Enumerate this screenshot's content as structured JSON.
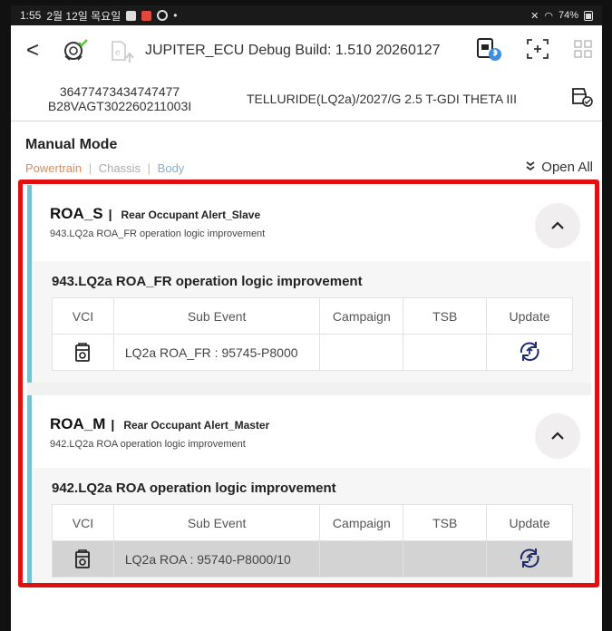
{
  "status_bar": {
    "time": "1:55",
    "date": "2월 12일 목요일",
    "battery": "74%"
  },
  "app_bar": {
    "back_label": "<",
    "title": "JUPITER_ECU Debug Build: 1.510 20260127",
    "icons": [
      "ecu-check-icon",
      "ecu-upload-icon",
      "bluetooth-vci-icon",
      "screen-capture-icon",
      "grid-menu-icon"
    ]
  },
  "vehicle": {
    "vin_line1": "36477473434747477",
    "vin_line2": "B28VAGT302260211003I",
    "model": "TELLURIDE(LQ2a)/2027/G 2.5 T-GDI THETA III"
  },
  "manual_mode": {
    "title": "Manual Mode",
    "filters": [
      "Powertrain",
      "Chassis",
      "Body"
    ],
    "separator": "|",
    "open_all": "Open All"
  },
  "colors": {
    "highlight": "#e01010",
    "accent": "#78c2cf",
    "powertrain": "#d98a5a",
    "body": "#7fb3d8"
  },
  "table_headers": [
    "VCI",
    "Sub Event",
    "Campaign",
    "TSB",
    "Update"
  ],
  "cards": [
    {
      "code": "ROA_S",
      "name": "Rear Occupant Alert_Slave",
      "subtitle": "943.LQ2a ROA_FR operation logic improvement",
      "body_title": "943.LQ2a ROA_FR operation logic improvement",
      "row": {
        "sub_event": "LQ2a ROA_FR : 95745-P8000",
        "campaign": "",
        "tsb": "",
        "selected": false
      }
    },
    {
      "code": "ROA_M",
      "name": "Rear Occupant Alert_Master",
      "subtitle": "942.LQ2a ROA operation logic improvement",
      "body_title": "942.LQ2a ROA operation logic improvement",
      "row": {
        "sub_event": "LQ2a ROA : 95740-P8000/10",
        "campaign": "",
        "tsb": "",
        "selected": true
      }
    }
  ]
}
